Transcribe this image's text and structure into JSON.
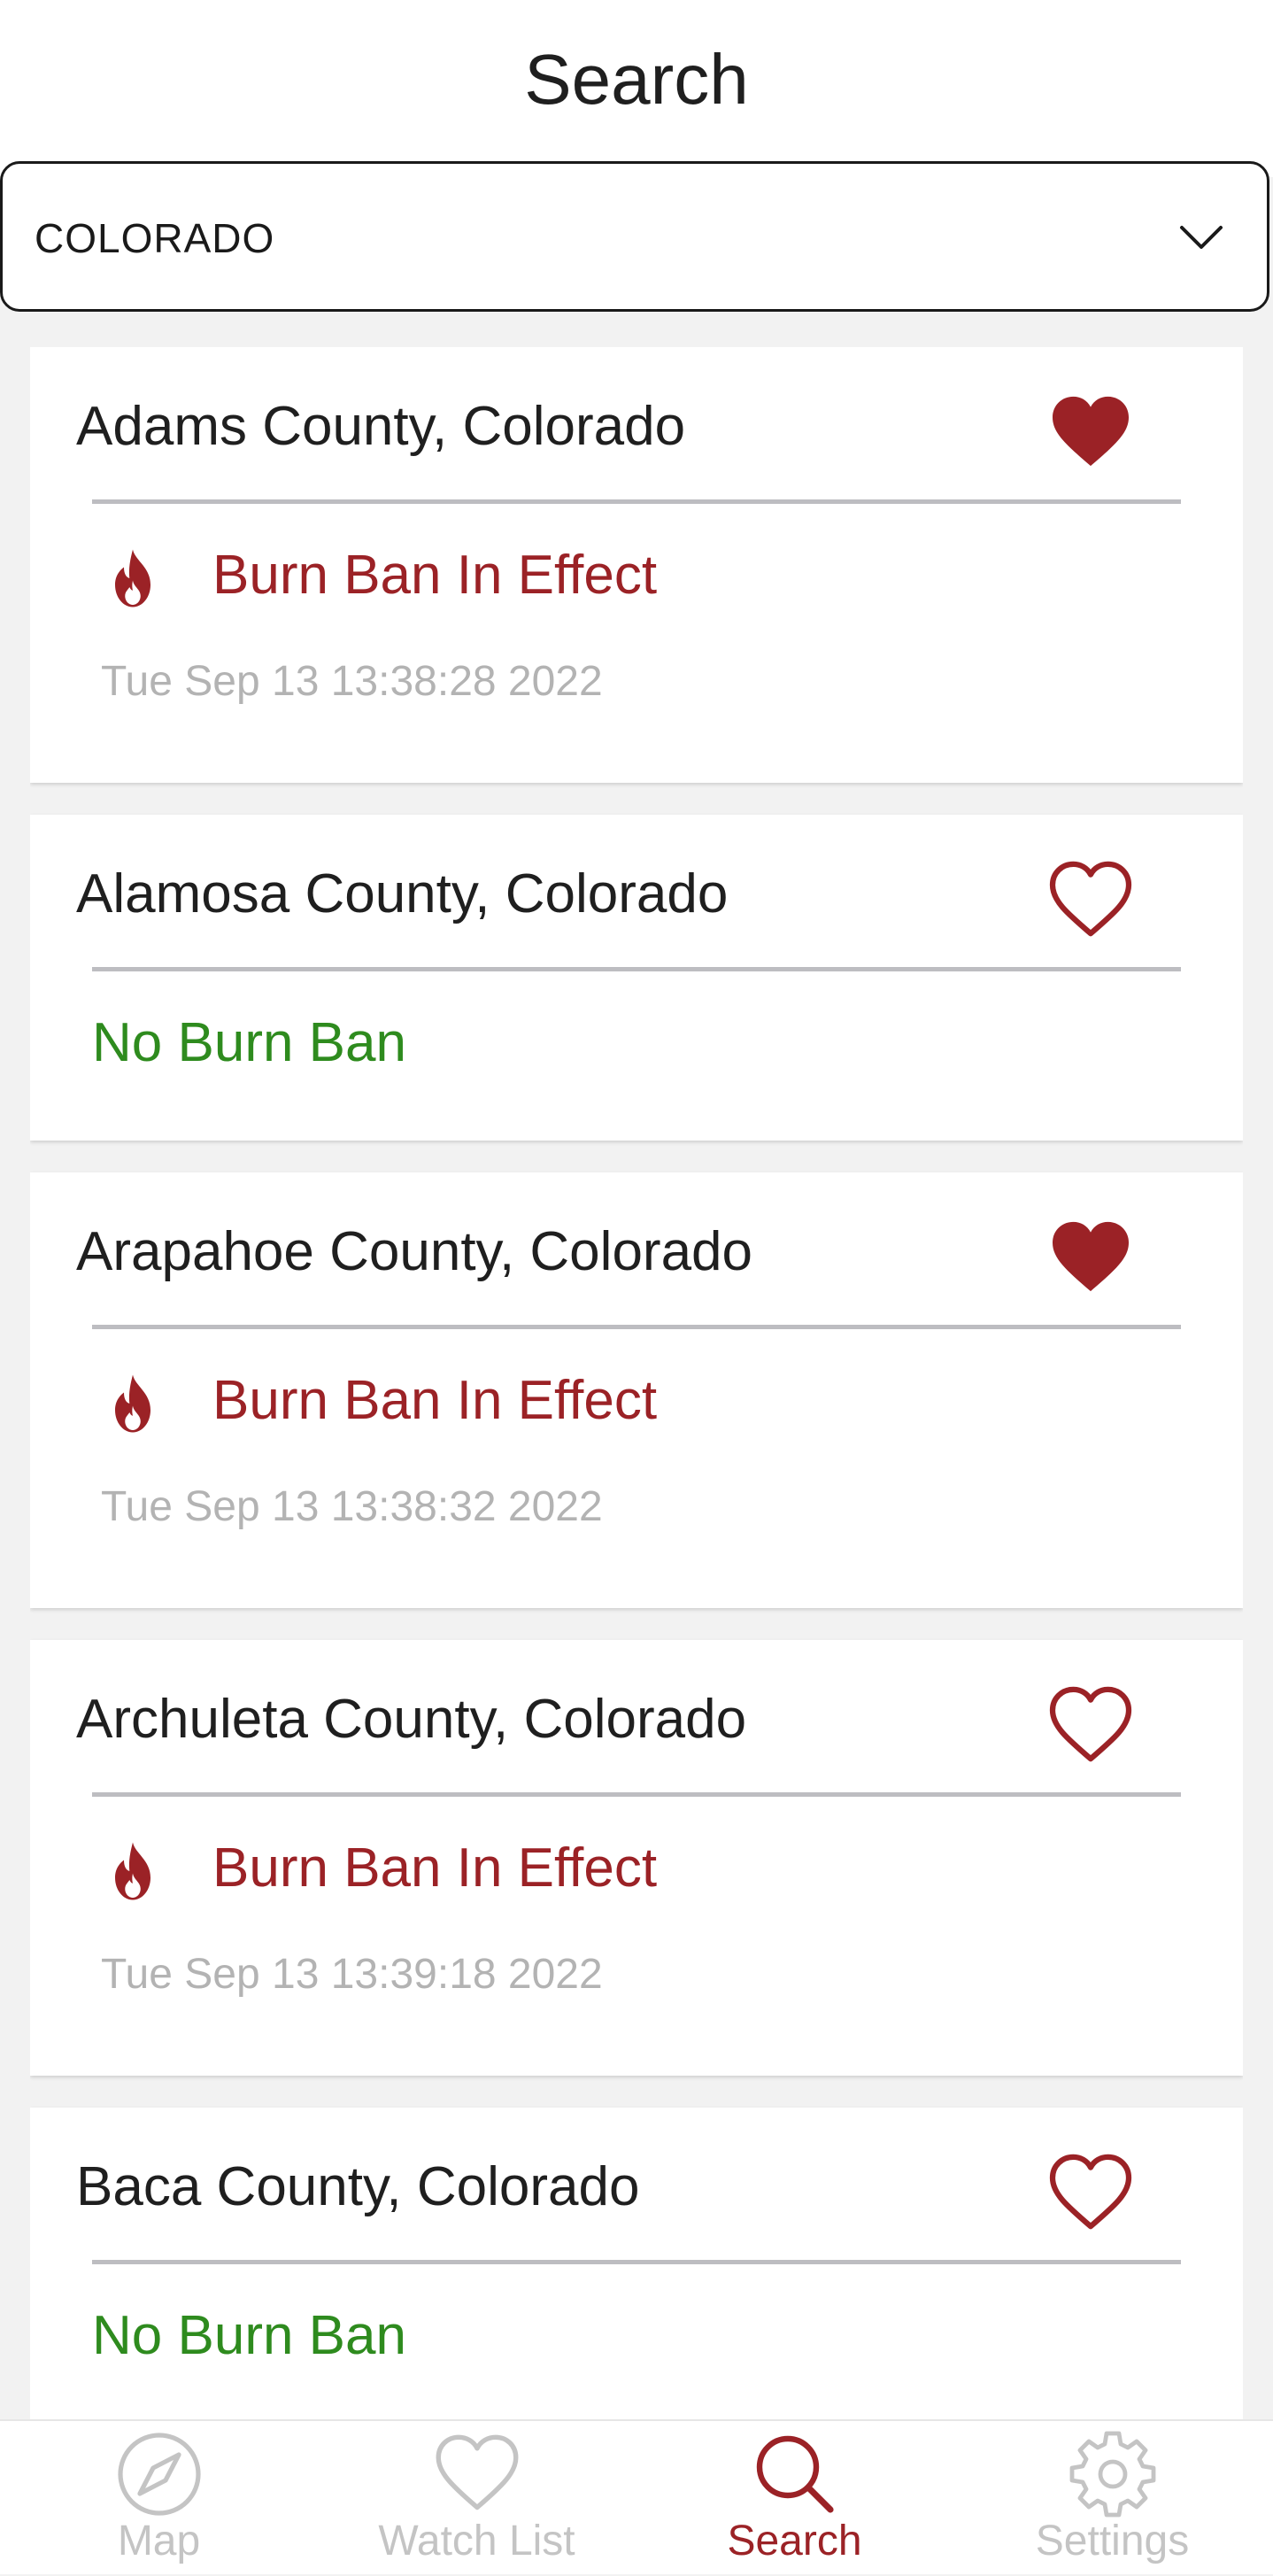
{
  "header": {
    "title": "Search"
  },
  "state_select": {
    "value": "COLORADO"
  },
  "colors": {
    "accent": "#9b2226",
    "no_ban": "#2e8b1e",
    "inactive_tab": "#c4c4c4",
    "timestamp": "#b3b3b3"
  },
  "counties": [
    {
      "name": "Adams County, Colorado",
      "favorited": true,
      "ban": true,
      "status": "Burn Ban In Effect",
      "updated": "Tue Sep 13 13:38:28 2022"
    },
    {
      "name": "Alamosa County, Colorado",
      "favorited": false,
      "ban": false,
      "status": "No Burn Ban"
    },
    {
      "name": "Arapahoe County, Colorado",
      "favorited": true,
      "ban": true,
      "status": "Burn Ban In Effect",
      "updated": "Tue Sep 13 13:38:32 2022"
    },
    {
      "name": "Archuleta County, Colorado",
      "favorited": false,
      "ban": true,
      "status": "Burn Ban In Effect",
      "updated": "Tue Sep 13 13:39:18 2022"
    },
    {
      "name": "Baca County, Colorado",
      "favorited": false,
      "ban": false,
      "status": "No Burn Ban"
    }
  ],
  "tabs": [
    {
      "label": "Map",
      "icon": "compass-icon",
      "active": false
    },
    {
      "label": "Watch List",
      "icon": "heart-icon",
      "active": false
    },
    {
      "label": "Search",
      "icon": "search-icon",
      "active": true
    },
    {
      "label": "Settings",
      "icon": "gear-icon",
      "active": false
    }
  ]
}
